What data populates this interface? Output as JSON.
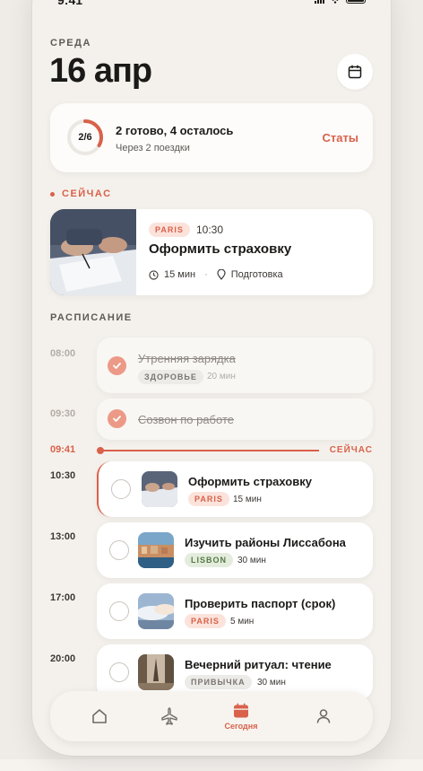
{
  "status": {
    "time": "9:41"
  },
  "header": {
    "day": "СРЕДА",
    "date": "16 апр"
  },
  "progress": {
    "ring_label": "2/6",
    "done": 2,
    "total": 6,
    "title": "2 готово, 4 осталось",
    "subtitle": "Через 2 поездки",
    "stats_link": "Статы"
  },
  "now_section": {
    "label": "СЕЙЧАС",
    "card": {
      "tag": "PARIS",
      "time": "10:30",
      "title": "Оформить страховку",
      "duration": "15 мин",
      "separator": "·",
      "category": "Подготовка"
    }
  },
  "schedule": {
    "label": "РАСПИСАНИЕ",
    "now_marker": {
      "time": "09:41",
      "label": "СЕЙЧАС"
    },
    "items": [
      {
        "time": "08:00",
        "title": "Утренняя зарядка",
        "tag": "ЗДОРОВЬЕ",
        "duration": "20 мин",
        "done": true
      },
      {
        "time": "09:30",
        "title": "Созвон по работе",
        "done": true
      },
      {
        "time": "10:30",
        "title": "Оформить страховку",
        "tag": "PARIS",
        "duration": "15 мин",
        "done": false,
        "thumb": "paperwork"
      },
      {
        "time": "13:00",
        "title": "Изучить районы Лиссабона",
        "tag": "LISBON",
        "duration": "30 мин",
        "done": false,
        "thumb": "lisbon"
      },
      {
        "time": "17:00",
        "title": "Проверить паспорт (срок)",
        "tag": "PARIS",
        "duration": "5 мин",
        "done": false,
        "thumb": "sky"
      },
      {
        "time": "20:00",
        "title": "Вечерний ритуал: чтение",
        "tag": "ПРИВЫЧКА",
        "duration": "30 мин",
        "done": false,
        "thumb": "eiffel"
      }
    ]
  },
  "tabbar": {
    "tabs": [
      {
        "icon": "home-icon"
      },
      {
        "icon": "plane-icon"
      },
      {
        "icon": "calendar-icon",
        "label": "Сегодня",
        "active": true
      },
      {
        "icon": "profile-icon"
      }
    ]
  },
  "colors": {
    "accent": "#d9614a",
    "done_check": "#ec9a87",
    "background": "#f4f1ec"
  }
}
